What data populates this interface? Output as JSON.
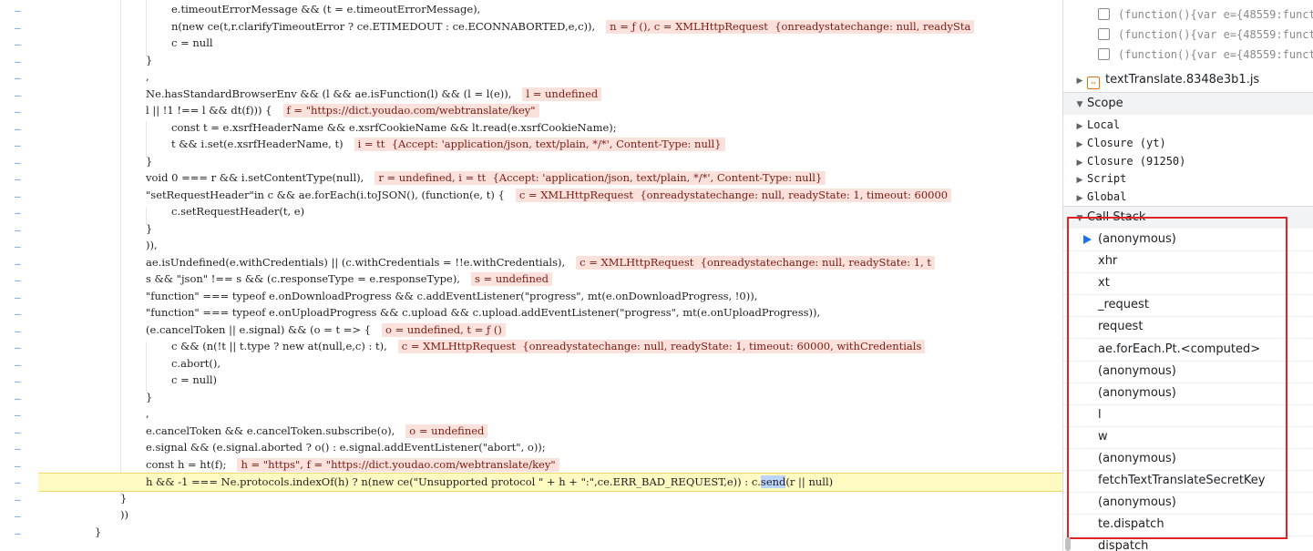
{
  "code": {
    "gutter_marks": [
      "–",
      "–",
      "–",
      "–",
      "–",
      "–",
      "–",
      "–",
      "–",
      "–",
      "–",
      "–",
      "–",
      "–",
      "–",
      "–",
      "–",
      "–",
      "–",
      "–",
      "–",
      "–",
      "–",
      "–",
      "–",
      "–",
      "–",
      "–",
      "–",
      "–",
      "–",
      "–"
    ],
    "lines": [
      {
        "text": "e.timeoutErrorMessage && (t = e.timeoutErrorMessage),",
        "value": ""
      },
      {
        "text": "n(new ce(t,r.clarifyTimeoutError ? ce.ETIMEDOUT : ce.ECONNABORTED,e,c)),",
        "value": "n = ƒ (), c = XMLHttpRequest  {onreadystatechange: null, readySta"
      },
      {
        "text": "c = null",
        "value": ""
      },
      {
        "text": "}",
        "value": ""
      },
      {
        "text": ",",
        "value": ""
      },
      {
        "text": "Ne.hasStandardBrowserEnv && (l && ae.isFunction(l) && (l = l(e)),",
        "value": "l = undefined"
      },
      {
        "text": "l || !1 !== l && dt(f))) {",
        "value": "f = \"https://dict.youdao.com/webtranslate/key\""
      },
      {
        "text": "const t = e.xsrfHeaderName && e.xsrfCookieName && lt.read(e.xsrfCookieName);",
        "value": ""
      },
      {
        "text": "t && i.set(e.xsrfHeaderName, t)",
        "value": "i = tt  {Accept: 'application/json, text/plain, */*', Content-Type: null}"
      },
      {
        "text": "}",
        "value": ""
      },
      {
        "text": "void 0 === r && i.setContentType(null),",
        "value": "r = undefined, i = tt  {Accept: 'application/json, text/plain, */*', Content-Type: null}"
      },
      {
        "text": "\"setRequestHeader\"in c && ae.forEach(i.toJSON(), (function(e, t) {",
        "value": "c = XMLHttpRequest  {onreadystatechange: null, readyState: 1, timeout: 60000"
      },
      {
        "text": "c.setRequestHeader(t, e)",
        "value": ""
      },
      {
        "text": "}",
        "value": ""
      },
      {
        "text": ")),",
        "value": ""
      },
      {
        "text": "ae.isUndefined(e.withCredentials) || (c.withCredentials = !!e.withCredentials),",
        "value": "c = XMLHttpRequest  {onreadystatechange: null, readyState: 1, t"
      },
      {
        "text": "s && \"json\" !== s && (c.responseType = e.responseType),",
        "value": "s = undefined"
      },
      {
        "text": "\"function\" === typeof e.onDownloadProgress && c.addEventListener(\"progress\", mt(e.onDownloadProgress, !0)),",
        "value": ""
      },
      {
        "text": "\"function\" === typeof e.onUploadProgress && c.upload && c.upload.addEventListener(\"progress\", mt(e.onUploadProgress)),",
        "value": ""
      },
      {
        "text": "(e.cancelToken || e.signal) && (o = t => {",
        "value": "o = undefined, t = ƒ ()"
      },
      {
        "text": "c && (n(!t || t.type ? new at(null,e,c) : t),",
        "value": "c = XMLHttpRequest  {onreadystatechange: null, readyState: 1, timeout: 60000, withCredentials"
      },
      {
        "text": "c.abort(),",
        "value": ""
      },
      {
        "text": "c = null)",
        "value": ""
      },
      {
        "text": "}",
        "value": ""
      },
      {
        "text": ",",
        "value": ""
      },
      {
        "text": "e.cancelToken && e.cancelToken.subscribe(o),",
        "value": "o = undefined"
      },
      {
        "text": "e.signal && (e.signal.aborted ? o() : e.signal.addEventListener(\"abort\", o));",
        "value": ""
      },
      {
        "text": "const h = ht(f);",
        "value": "h = \"https\", f = \"https://dict.youdao.com/webtranslate/key\""
      },
      {
        "text_before": "h && -1 === Ne.protocols.indexOf(h) ? n(new ce(\"Unsupported protocol \" + h + \":\",ce.ERR_BAD_REQUEST,e)) : c.",
        "text_highlight": "send",
        "text_after": "(r || null)",
        "value": ""
      },
      {
        "text": "}",
        "value": ""
      },
      {
        "text": "))",
        "value": ""
      },
      {
        "text": "}",
        "value": ""
      }
    ]
  },
  "sidebar": {
    "breakpoints": [
      {
        "label": "(function(){var e={48559:functio"
      },
      {
        "label": "(function(){var e={48559:functio"
      },
      {
        "label": "(function(){var e={48559:functio"
      }
    ],
    "file": {
      "icon": "file-script-icon",
      "label": "textTranslate.8348e3b1.js"
    },
    "scope": {
      "title": "Scope",
      "items": [
        "Local",
        "Closure (yt)",
        "Closure (91250)",
        "Script",
        "Global"
      ]
    },
    "call_stack": {
      "title": "Call Stack",
      "frames": [
        "(anonymous)",
        "xhr",
        "xt",
        "_request",
        "request",
        "ae.forEach.Pt.<computed>",
        "(anonymous)",
        "(anonymous)",
        "l",
        "w",
        "(anonymous)",
        "fetchTextTranslateSecretKey",
        "(anonymous)",
        "te.dispatch",
        "dispatch"
      ],
      "active_index": 0
    }
  },
  "colors": {
    "inline_value_bg": "#fbe1dc",
    "paused_line_bg": "#fff9c2",
    "annotation_box": "#e02424",
    "active_frame_arrow": "#1a73e8"
  }
}
